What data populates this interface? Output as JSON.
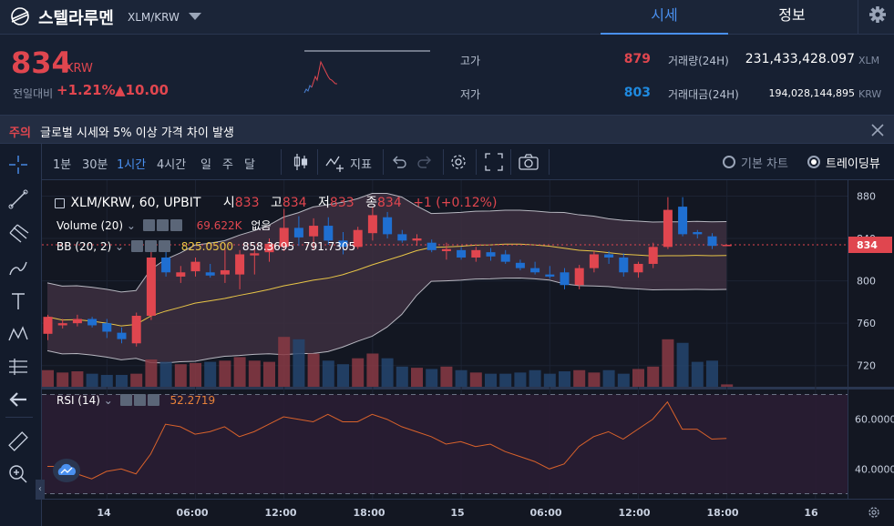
{
  "header": {
    "coin_name": "스텔라루멘",
    "pair": "XLM/KRW",
    "tab_quote": "시세",
    "tab_info": "정보"
  },
  "price": {
    "value": "834",
    "unit": "KRW",
    "change_label": "전일대비",
    "change_pct": "+1.21%",
    "change_abs": "▲10.00"
  },
  "stats": {
    "high_label": "고가",
    "high": "879",
    "low_label": "저가",
    "low": "803",
    "volume_label": "거래량(24H)",
    "volume": "231,433,428.097",
    "volume_unit": "XLM",
    "amount_label": "거래대금(24H)",
    "amount": "194,028,144,895",
    "amount_unit": "KRW"
  },
  "notice": {
    "tag": "주의",
    "text": "글로벌 시세와 5% 이상 가격 차이 발생"
  },
  "toolbar": {
    "intervals": [
      "1분",
      "30분",
      "1시간",
      "4시간",
      "일",
      "주",
      "달"
    ],
    "active_interval": "1시간",
    "indicator_label": "지표",
    "basic_chart_label": "기본 차트",
    "tradingview_label": "트레이딩뷰"
  },
  "legend": {
    "symbol": "XLM/KRW, 60, UPBIT",
    "open_label": "시",
    "open": "833",
    "high_label": "고",
    "high": "834",
    "low_label": "저",
    "low": "833",
    "close_label": "종",
    "close": "834",
    "change": "+1 (+0.12%)",
    "volume_label": "Volume (20)",
    "volume_value": "69.622K",
    "volume_extra": "없음",
    "bb_label": "BB (20, 2)",
    "bb_mid": "825.0500",
    "bb_upper": "858.3695",
    "bb_lower": "791.7305",
    "rsi_label": "RSI (14)",
    "rsi_value": "52.2719"
  },
  "axes": {
    "price_ticks": [
      "880",
      "840",
      "800",
      "760",
      "720"
    ],
    "current_price_tag": "834",
    "rsi_ticks": [
      "60.0000",
      "40.0000"
    ],
    "time_ticks": [
      "14",
      "06:00",
      "12:00",
      "18:00",
      "15",
      "06:00",
      "12:00",
      "18:00",
      "16"
    ]
  },
  "colors": {
    "up": "#e0464f",
    "down": "#1f6fd1",
    "accent": "#4a90f0",
    "bb_mid": "#e8c547"
  },
  "chart_data": {
    "type": "candlestick",
    "interval": "1시간",
    "ylim": [
      700,
      895
    ],
    "candles": [
      {
        "o": 750,
        "h": 768,
        "l": 744,
        "c": 766
      },
      {
        "o": 758,
        "h": 764,
        "l": 755,
        "c": 760
      },
      {
        "o": 760,
        "h": 768,
        "l": 757,
        "c": 764
      },
      {
        "o": 764,
        "h": 766,
        "l": 756,
        "c": 758
      },
      {
        "o": 760,
        "h": 764,
        "l": 746,
        "c": 752
      },
      {
        "o": 751,
        "h": 756,
        "l": 741,
        "c": 745
      },
      {
        "o": 741,
        "h": 770,
        "l": 738,
        "c": 767
      },
      {
        "o": 767,
        "h": 828,
        "l": 763,
        "c": 822
      },
      {
        "o": 822,
        "h": 828,
        "l": 804,
        "c": 808
      },
      {
        "o": 804,
        "h": 814,
        "l": 798,
        "c": 808
      },
      {
        "o": 809,
        "h": 822,
        "l": 804,
        "c": 818
      },
      {
        "o": 808,
        "h": 816,
        "l": 803,
        "c": 805
      },
      {
        "o": 806,
        "h": 830,
        "l": 798,
        "c": 810
      },
      {
        "o": 806,
        "h": 829,
        "l": 792,
        "c": 825
      },
      {
        "o": 824,
        "h": 832,
        "l": 806,
        "c": 826
      },
      {
        "o": 827,
        "h": 840,
        "l": 818,
        "c": 835
      },
      {
        "o": 832,
        "h": 868,
        "l": 828,
        "c": 850
      },
      {
        "o": 850,
        "h": 861,
        "l": 833,
        "c": 841
      },
      {
        "o": 842,
        "h": 859,
        "l": 829,
        "c": 852
      },
      {
        "o": 852,
        "h": 860,
        "l": 834,
        "c": 838
      },
      {
        "o": 838,
        "h": 846,
        "l": 825,
        "c": 832
      },
      {
        "o": 832,
        "h": 851,
        "l": 830,
        "c": 848
      },
      {
        "o": 845,
        "h": 870,
        "l": 838,
        "c": 862
      },
      {
        "o": 860,
        "h": 865,
        "l": 840,
        "c": 844
      },
      {
        "o": 844,
        "h": 848,
        "l": 836,
        "c": 838
      },
      {
        "o": 838,
        "h": 844,
        "l": 833,
        "c": 840
      },
      {
        "o": 836,
        "h": 839,
        "l": 827,
        "c": 829
      },
      {
        "o": 828,
        "h": 836,
        "l": 820,
        "c": 830
      },
      {
        "o": 829,
        "h": 832,
        "l": 820,
        "c": 822
      },
      {
        "o": 822,
        "h": 832,
        "l": 818,
        "c": 829
      },
      {
        "o": 827,
        "h": 831,
        "l": 819,
        "c": 823
      },
      {
        "o": 825,
        "h": 829,
        "l": 816,
        "c": 818
      },
      {
        "o": 817,
        "h": 820,
        "l": 810,
        "c": 812
      },
      {
        "o": 812,
        "h": 818,
        "l": 806,
        "c": 808
      },
      {
        "o": 806,
        "h": 814,
        "l": 802,
        "c": 804
      },
      {
        "o": 808,
        "h": 812,
        "l": 792,
        "c": 796
      },
      {
        "o": 796,
        "h": 815,
        "l": 792,
        "c": 812
      },
      {
        "o": 812,
        "h": 828,
        "l": 808,
        "c": 825
      },
      {
        "o": 825,
        "h": 828,
        "l": 816,
        "c": 822
      },
      {
        "o": 822,
        "h": 826,
        "l": 804,
        "c": 808
      },
      {
        "o": 808,
        "h": 818,
        "l": 803,
        "c": 816
      },
      {
        "o": 816,
        "h": 836,
        "l": 812,
        "c": 832
      },
      {
        "o": 832,
        "h": 879,
        "l": 830,
        "c": 867
      },
      {
        "o": 870,
        "h": 879,
        "l": 842,
        "c": 844
      },
      {
        "o": 846,
        "h": 848,
        "l": 840,
        "c": 844
      },
      {
        "o": 842,
        "h": 845,
        "l": 830,
        "c": 833
      },
      {
        "o": 833,
        "h": 834,
        "l": 833,
        "c": 834
      }
    ],
    "volume": [
      14,
      12,
      13,
      11,
      10,
      10,
      11,
      23,
      21,
      19,
      20,
      21,
      22,
      25,
      22,
      21,
      42,
      40,
      28,
      22,
      19,
      24,
      28,
      24,
      17,
      16,
      15,
      17,
      14,
      12,
      11,
      11,
      12,
      14,
      11,
      13,
      14,
      12,
      14,
      11,
      15,
      17,
      40,
      37,
      21,
      22,
      2
    ],
    "rsi": [
      41,
      41,
      38,
      36,
      39,
      40,
      38,
      46,
      58,
      57,
      54,
      55,
      57,
      53,
      55,
      58,
      61,
      60,
      59,
      62,
      59,
      59,
      62,
      60,
      57,
      55,
      53,
      50,
      51,
      49,
      50,
      47,
      45,
      43,
      40,
      42,
      49,
      53,
      55,
      52,
      56,
      60,
      67,
      56,
      56,
      52,
      52.3
    ],
    "rsi_ylim": [
      28,
      72
    ]
  }
}
